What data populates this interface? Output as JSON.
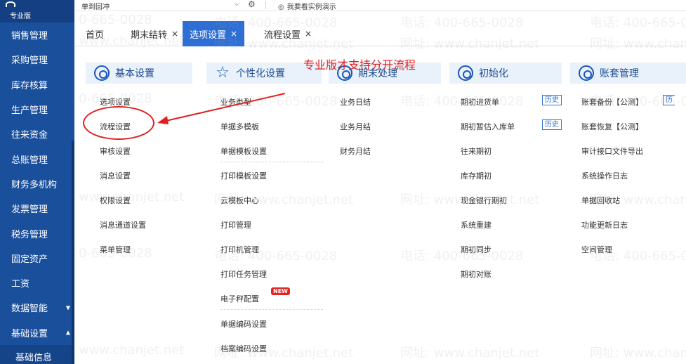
{
  "sidebar": {
    "edition": "专业版",
    "items": [
      {
        "label": "销售管理"
      },
      {
        "label": "采购管理"
      },
      {
        "label": "库存核算"
      },
      {
        "label": "生产管理"
      },
      {
        "label": "往来资金"
      },
      {
        "label": "总账管理"
      },
      {
        "label": "财务多机构"
      },
      {
        "label": "发票管理"
      },
      {
        "label": "税务管理"
      },
      {
        "label": "固定资产"
      },
      {
        "label": "工资"
      },
      {
        "label": "数据智能",
        "arrow": "▼"
      },
      {
        "label": "基础设置",
        "arrow": "▲"
      }
    ],
    "sub_item": "基础信息"
  },
  "topbar": {
    "select_value": "单到回冲",
    "chevron": "⌵",
    "gear": "⚙",
    "demo_eye": "◎",
    "demo_label": "我要看实例演示"
  },
  "tabs": [
    {
      "label": "首页",
      "close": ""
    },
    {
      "label": "期末结转",
      "close": "×"
    },
    {
      "label": "选项设置",
      "close": "×",
      "active": true
    },
    {
      "label": "流程设置",
      "close": "×"
    }
  ],
  "columns": [
    {
      "title": "基本设置",
      "icon": "gear-icon",
      "items": [
        "选项设置",
        "流程设置",
        "审核设置",
        "消息设置",
        "权限设置",
        "消息通道设置",
        "菜单管理"
      ]
    },
    {
      "title": "个性化设置",
      "icon": "star-icon",
      "items": [
        "业务类型",
        "单据多模板",
        "单据模板设置",
        "打印模板设置",
        "云模板中心",
        "打印管理",
        "打印机管理",
        "打印任务管理",
        "电子秤配置",
        "单据编码设置",
        "档案编码设置"
      ]
    },
    {
      "title": "期末处理",
      "icon": "refresh-icon",
      "items": [
        "业务日结",
        "业务月结",
        "财务月结"
      ]
    },
    {
      "title": "初始化",
      "icon": "link-icon",
      "items": [
        "期初进货单",
        "期初暂估入库单",
        "往来期初",
        "库存期初",
        "现金银行期初",
        "系统重建",
        "期初同步",
        "期初对账"
      ]
    },
    {
      "title": "账套管理",
      "icon": "database-icon",
      "items": [
        "账套备份【公测】",
        "账套恢复【公测】",
        "审计接口文件导出",
        "系统操作日志",
        "单据回收站",
        "功能更新日志",
        "空间管理"
      ]
    }
  ],
  "badges": {
    "history": "历史",
    "history_partial": "历",
    "new": "NEW"
  },
  "annotation": "专业版才支持分开流程",
  "watermark": {
    "phone": "电话: 400-665-0028",
    "phone_partial": "0-665-0028",
    "site": "网址: www.chanjet.net",
    "site_partial": "www.chanjet.net"
  }
}
